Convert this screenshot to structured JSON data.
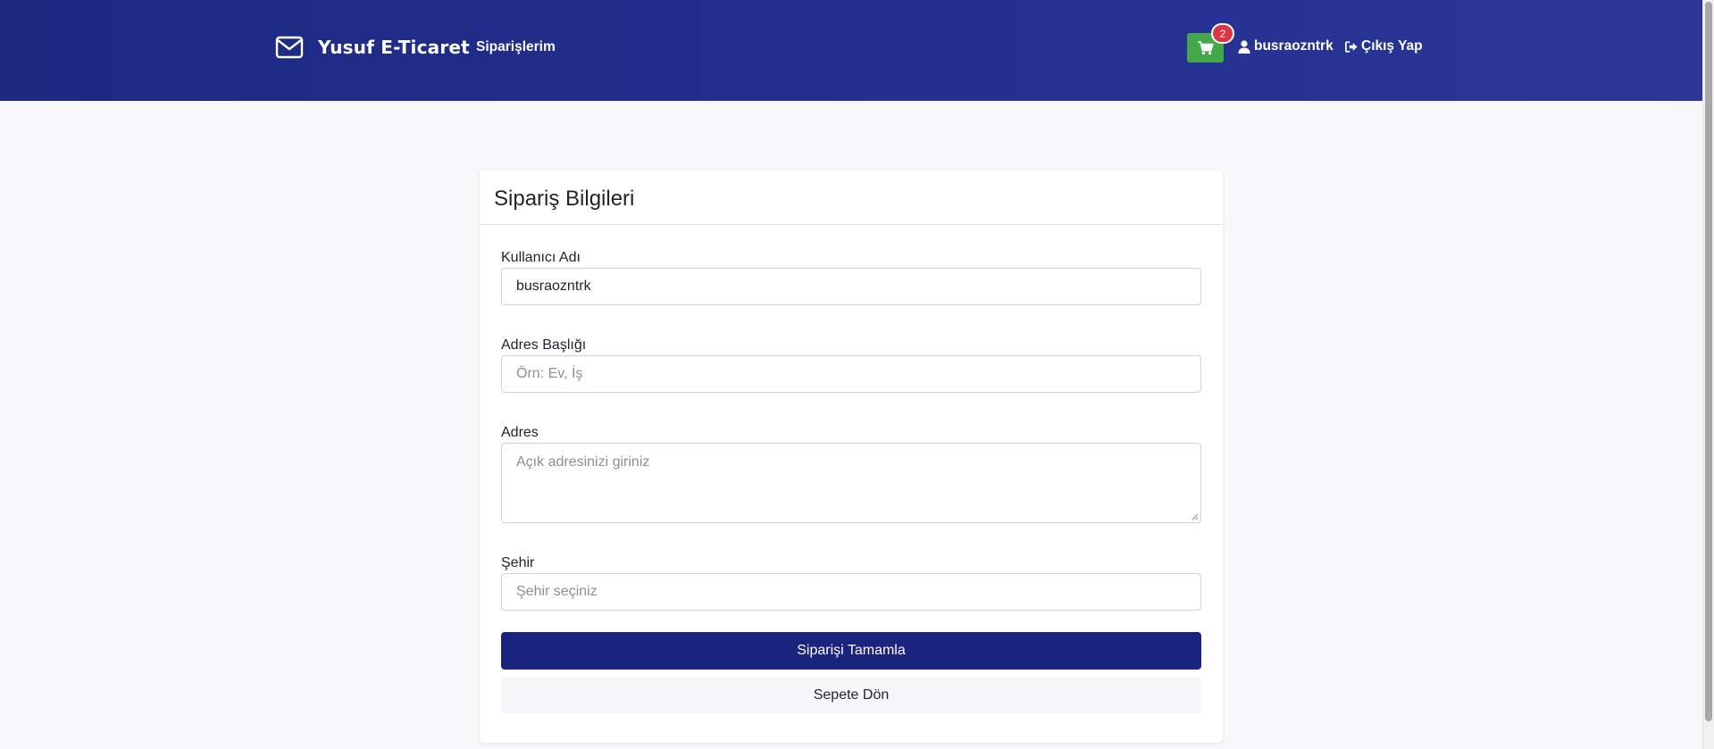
{
  "navbar": {
    "brand_icon": "envelope-icon",
    "brand": "Yusuf E-Ticaret",
    "orders_link": "Siparişlerim",
    "cart_icon": "shopping-cart-icon",
    "cart_count": "2",
    "user_icon": "user-icon",
    "username": "busraozntrk",
    "logout_icon": "sign-out-icon",
    "logout": "Çıkış Yap",
    "colors": {
      "background": "#1d2a80",
      "cart_button": "#43a84a",
      "badge": "#dc3545"
    }
  },
  "card": {
    "title": "Sipariş Bilgileri"
  },
  "form": {
    "username": {
      "label": "Kullanıcı Adı",
      "value": "busraozntrk"
    },
    "address_title": {
      "label": "Adres Başlığı",
      "value": "",
      "placeholder": "Örn: Ev, İş"
    },
    "address": {
      "label": "Adres",
      "value": "",
      "placeholder": "Açık adresinizi giriniz"
    },
    "city": {
      "label": "Şehir",
      "value": "",
      "placeholder": "Şehir seçiniz"
    },
    "submit_label": "Siparişi Tamamla",
    "back_label": "Sepete Dön",
    "colors": {
      "primary": "#1a237e",
      "secondary": "#f6f7f9"
    }
  }
}
